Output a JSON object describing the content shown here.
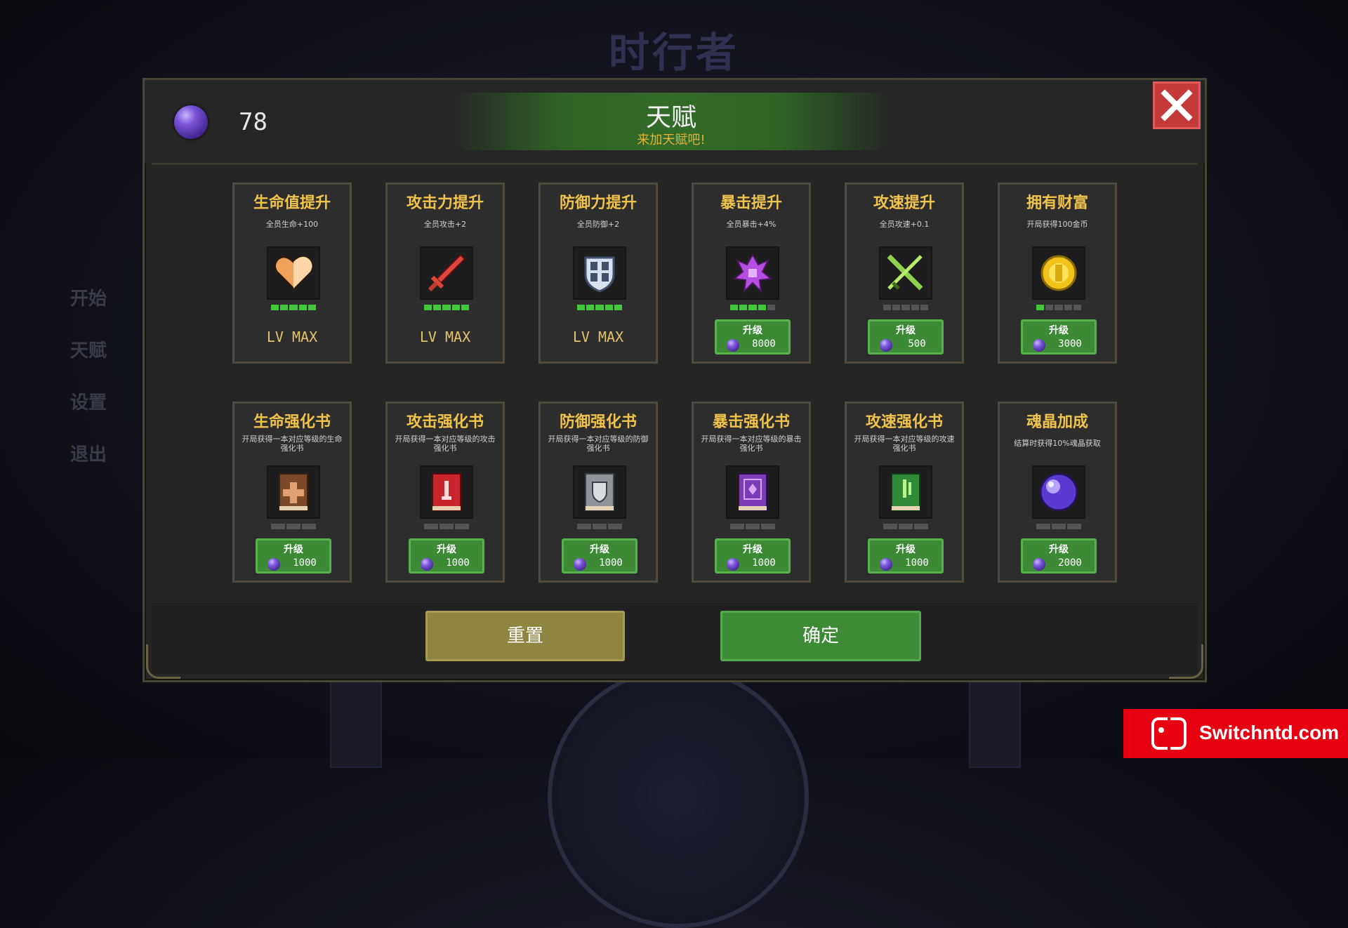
{
  "background": {
    "title": "时行者",
    "menu": [
      "开始",
      "天赋",
      "设置",
      "退出"
    ]
  },
  "header": {
    "currency_amount": "78",
    "title": "天赋",
    "subtitle": "来加天赋吧!",
    "close_icon": "close-icon"
  },
  "talents": [
    {
      "title": "生命值提升",
      "desc": "全员生命+100",
      "icon": "heart-icon",
      "level": 5,
      "max_level": 5,
      "status": "LV MAX",
      "upgrade_label": "",
      "cost": ""
    },
    {
      "title": "攻击力提升",
      "desc": "全员攻击+2",
      "icon": "sword-icon",
      "level": 5,
      "max_level": 5,
      "status": "LV MAX",
      "upgrade_label": "",
      "cost": ""
    },
    {
      "title": "防御力提升",
      "desc": "全员防御+2",
      "icon": "shield-icon",
      "level": 5,
      "max_level": 5,
      "status": "LV MAX",
      "upgrade_label": "",
      "cost": ""
    },
    {
      "title": "暴击提升",
      "desc": "全员暴击+4%",
      "icon": "crit-icon",
      "level": 4,
      "max_level": 5,
      "status": "",
      "upgrade_label": "升级",
      "cost": "8000"
    },
    {
      "title": "攻速提升",
      "desc": "全员攻速+0.1",
      "icon": "dual-swords-icon",
      "level": 0,
      "max_level": 5,
      "status": "",
      "upgrade_label": "升级",
      "cost": "500"
    },
    {
      "title": "拥有财富",
      "desc": "开局获得100金币",
      "icon": "coin-icon",
      "level": 1,
      "max_level": 5,
      "status": "",
      "upgrade_label": "升级",
      "cost": "3000"
    },
    {
      "title": "生命强化书",
      "desc": "开局获得一本对应等级的生命强化书",
      "icon": "brown-book-icon",
      "level": 0,
      "max_level": 3,
      "status": "",
      "upgrade_label": "升级",
      "cost": "1000"
    },
    {
      "title": "攻击强化书",
      "desc": "开局获得一本对应等级的攻击强化书",
      "icon": "red-book-icon",
      "level": 0,
      "max_level": 3,
      "status": "",
      "upgrade_label": "升级",
      "cost": "1000"
    },
    {
      "title": "防御强化书",
      "desc": "开局获得一本对应等级的防御强化书",
      "icon": "grey-book-icon",
      "level": 0,
      "max_level": 3,
      "status": "",
      "upgrade_label": "升级",
      "cost": "1000"
    },
    {
      "title": "暴击强化书",
      "desc": "开局获得一本对应等级的暴击强化书",
      "icon": "purple-book-icon",
      "level": 0,
      "max_level": 3,
      "status": "",
      "upgrade_label": "升级",
      "cost": "1000"
    },
    {
      "title": "攻速强化书",
      "desc": "开局获得一本对应等级的攻速强化书",
      "icon": "green-book-icon",
      "level": 0,
      "max_level": 3,
      "status": "",
      "upgrade_label": "升级",
      "cost": "1000"
    },
    {
      "title": "魂晶加成",
      "desc": "结算时获得10%魂晶获取",
      "icon": "soul-crystal-icon",
      "level": 0,
      "max_level": 3,
      "status": "",
      "upgrade_label": "升级",
      "cost": "2000"
    }
  ],
  "footer": {
    "reset_label": "重置",
    "confirm_label": "确定"
  },
  "watermark": {
    "text": "Switchntd.com"
  },
  "colors": {
    "accent_green": "#3c8a36",
    "title_gold": "#f0c44c",
    "close_red": "#c43a3a",
    "reset_olive": "#8e8540"
  }
}
